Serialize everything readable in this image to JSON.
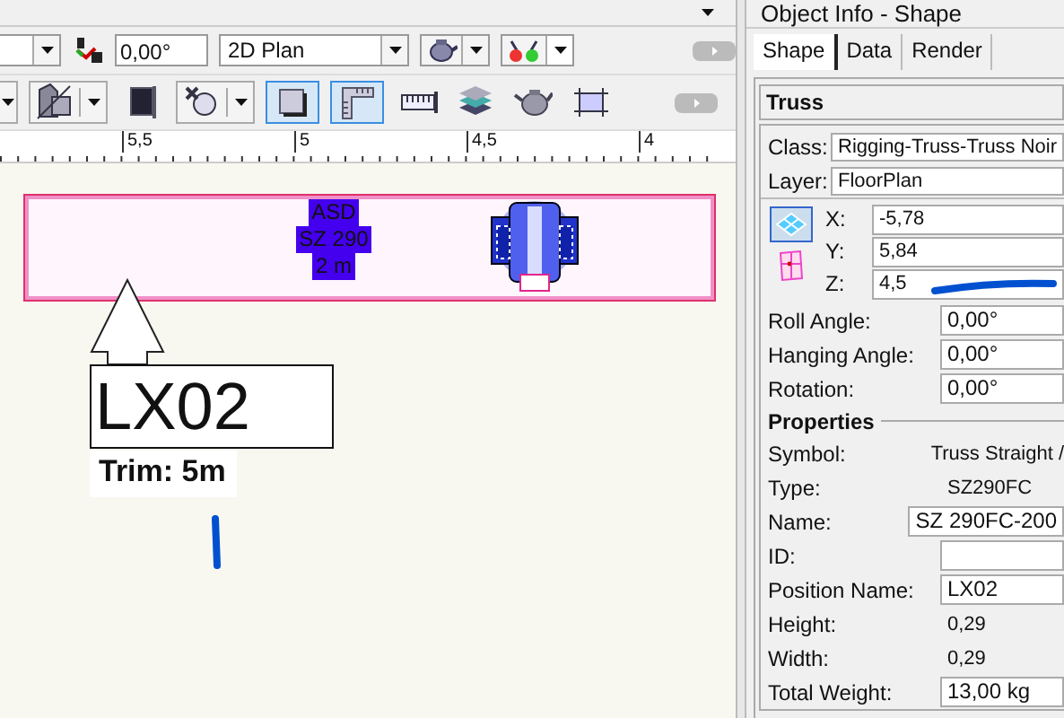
{
  "toolbar_1": {
    "angle_field": "0,00°",
    "view_dropdown": "2D Plan"
  },
  "toolbar_2": {
    "tools": [
      {
        "kind": "dropdown-stub",
        "selected": false
      },
      {
        "kind": "shape",
        "selected": false,
        "dropdown": true
      },
      {
        "kind": "frame",
        "selected": false,
        "dropdown": false
      },
      {
        "kind": "attach",
        "selected": false,
        "dropdown": true
      },
      {
        "kind": "square",
        "selected": true,
        "dropdown": false
      },
      {
        "kind": "ruler",
        "selected": true,
        "dropdown": false
      },
      {
        "kind": "dimension",
        "selected": false,
        "dropdown": false
      },
      {
        "kind": "layers",
        "selected": false,
        "dropdown": false
      },
      {
        "kind": "pot",
        "selected": false,
        "dropdown": false
      },
      {
        "kind": "bounds",
        "selected": false,
        "dropdown": false
      }
    ]
  },
  "ruler": {
    "labels": [
      "5,5",
      "5",
      "4,5",
      "4"
    ]
  },
  "canvas": {
    "truss_label": [
      "ASD",
      "SZ 290",
      "2 m"
    ],
    "callout": "LX02",
    "trim": "Trim: 5m"
  },
  "object_info": {
    "title": "Object Info - Shape",
    "tabs": [
      {
        "label": "Shape",
        "selected": true
      },
      {
        "label": "Data",
        "selected": false
      },
      {
        "label": "Render",
        "selected": false
      }
    ],
    "object_type": "Truss",
    "class": {
      "label": "Class:",
      "value": "Rigging-Truss-Truss Noir"
    },
    "layer": {
      "label": "Layer:",
      "value": "FloorPlan"
    },
    "coords": [
      {
        "label": "X:",
        "value": "-5,78"
      },
      {
        "label": "Y:",
        "value": "5,84"
      },
      {
        "label": "Z:",
        "value": "4,5"
      }
    ],
    "angles": [
      {
        "label": "Roll Angle:",
        "value": "0,00°"
      },
      {
        "label": "Hanging Angle:",
        "value": "0,00°"
      },
      {
        "label": "Rotation:",
        "value": "0,00°"
      }
    ],
    "properties_title": "Properties",
    "properties": [
      {
        "label": "Symbol:",
        "value": "Truss Straight /",
        "kind": "text"
      },
      {
        "label": "Type:",
        "value": "SZ290FC",
        "kind": "text"
      },
      {
        "label": "Name:",
        "value": "SZ 290FC-200",
        "kind": "field"
      },
      {
        "label": "ID:",
        "kind": "field"
      },
      {
        "label": "Position Name:",
        "value": "LX02",
        "kind": "field"
      },
      {
        "label": "Height:",
        "value": "0,29",
        "kind": "text"
      },
      {
        "label": "Width:",
        "value": "0,29",
        "kind": "text"
      },
      {
        "label": "Total Weight:",
        "value": "13,00 kg",
        "kind": "field"
      }
    ]
  }
}
